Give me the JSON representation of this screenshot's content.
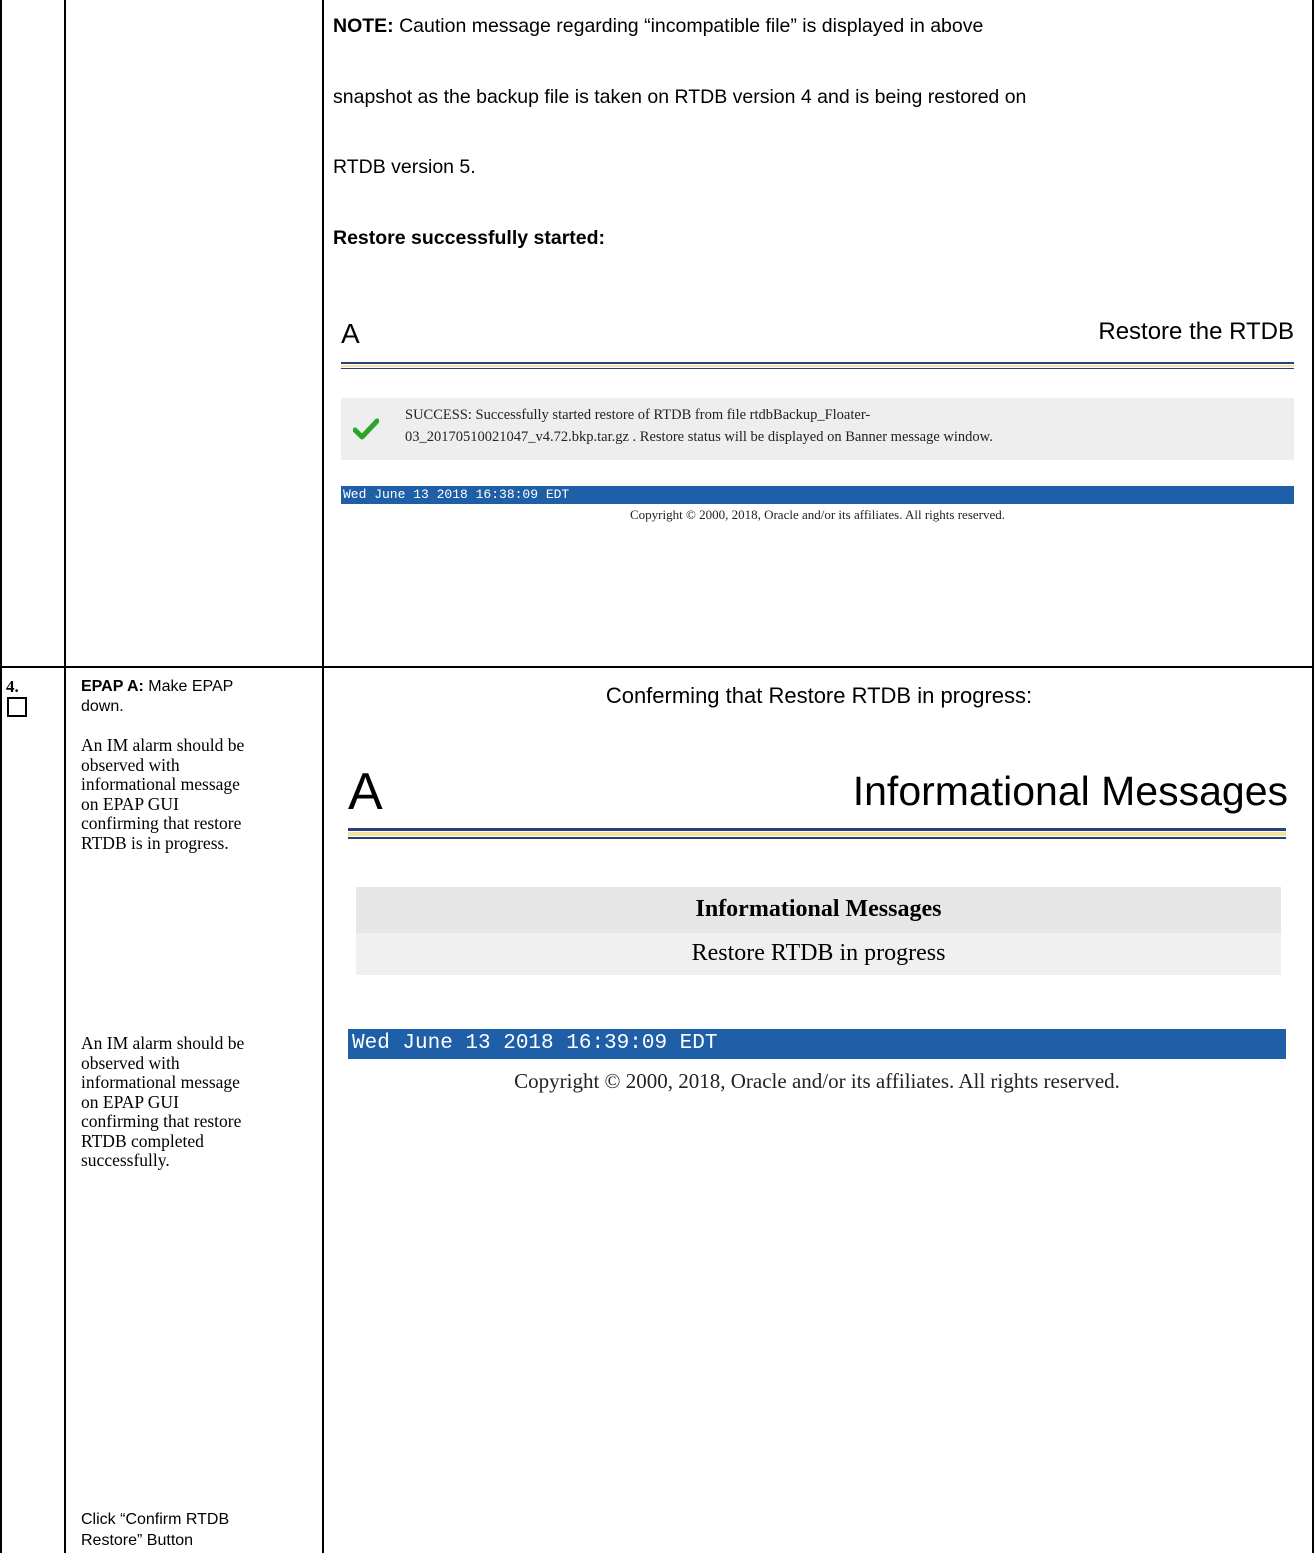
{
  "top_row": {
    "note_label": "NOTE:",
    "note_line1": "Caution message regarding “incompatible file” is displayed in above",
    "note_line2": "snapshot as the backup file is taken on RTDB version 4 and is being restored on",
    "note_line3": "RTDB version 5.",
    "restore_heading": "Restore successfully started:",
    "screenshot": {
      "letter": "A",
      "title": "Restore the RTDB",
      "success_line1": "SUCCESS: Successfully started restore of RTDB from file rtdbBackup_Floater-",
      "success_line2": "03_20170510021047_v4.72.bkp.tar.gz . Restore status will be displayed on Banner message window.",
      "timestamp": "Wed June 13 2018 16:38:09 EDT",
      "copyright": "Copyright © 2000, 2018, Oracle and/or its affiliates. All rights reserved."
    }
  },
  "step4": {
    "number": "4.",
    "label_bold": "EPAP A:",
    "label_line1": " Make EPAP",
    "label_line2": "down.",
    "im1_lines": [
      "An IM alarm should be",
      "observed with",
      "informational message",
      "on EPAP GUI",
      "confirming that restore",
      "RTDB is in progress."
    ],
    "im2_lines": [
      "An IM alarm should be",
      "observed with",
      "informational message",
      "on EPAP GUI",
      "confirming that restore",
      "RTDB completed",
      "successfully."
    ],
    "click_line1": "Click “Confirm RTDB",
    "click_line2": "Restore” Button",
    "confirm_heading": "Conferming that Restore RTDB in progress:",
    "screenshot": {
      "letter": "A",
      "title": "Informational Messages",
      "box_header": "Informational Messages",
      "box_message": "Restore RTDB in progress",
      "timestamp": "Wed June 13 2018 16:39:09 EDT",
      "copyright": "Copyright © 2000, 2018, Oracle and/or its affiliates. All rights reserved."
    }
  }
}
